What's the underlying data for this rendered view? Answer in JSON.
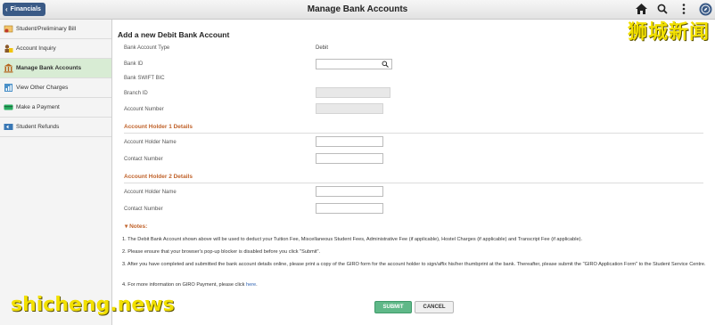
{
  "topbar": {
    "back_label": "Financials",
    "title": "Manage Bank Accounts",
    "icons": [
      "home-icon",
      "search-icon",
      "more-vertical-icon",
      "navbar-compass-icon"
    ]
  },
  "sidebar": {
    "items": [
      {
        "label": "Student/Preliminary Bill",
        "icon": "bill-icon"
      },
      {
        "label": "Account Inquiry",
        "icon": "account-inquiry-icon"
      },
      {
        "label": "Manage Bank Accounts",
        "icon": "bank-icon"
      },
      {
        "label": "View Other Charges",
        "icon": "charges-icon"
      },
      {
        "label": "Make a Payment",
        "icon": "payment-icon"
      },
      {
        "label": "Student Refunds",
        "icon": "refunds-icon"
      }
    ]
  },
  "form": {
    "title": "Add a new Debit Bank Account",
    "bank_account_type_label": "Bank Account Type",
    "bank_account_type_value": "Debit",
    "bank_id_label": "Bank ID",
    "bank_id_value": "",
    "bank_swift_label": "Bank SWIFT BIC",
    "branch_id_label": "Branch ID",
    "account_number_label": "Account Number",
    "holder1_heading": "Account Holder 1 Details",
    "holder1_name_label": "Account Holder Name",
    "holder1_contact_label": "Contact Number",
    "holder2_heading": "Account Holder 2 Details",
    "holder2_name_label": "Account Holder Name",
    "holder2_contact_label": "Contact Number"
  },
  "notes": {
    "heading": "Notes:",
    "items": [
      "1.  The Debit Bank Account shown above will be used to deduct your Tuition Fee, Miscellaneous Student Fees, Administrative Fee (if applicable), Hostel Charges (if applicable) and Transcript Fee (if applicable).",
      "2.  Please ensure that your browser's pop-up blocker is disabled before you click \"Submit\".",
      "3.  After you have completed and submitted the bank account details online, please print a copy of the GIRO form for the account holder to sign/affix his/her thumbprint at the bank. Thereafter, please submit the \"GIRO Application Form\" to the Student Service Centre.",
      "4.  For more information on GIRO Payment, please click "
    ],
    "link_label": "here",
    "link_suffix": "."
  },
  "buttons": {
    "submit_label": "SUBMIT",
    "cancel_label": "CANCEL"
  },
  "watermarks": {
    "chinese": "狮城新闻",
    "english": "shicheng.news"
  },
  "colors": {
    "accent_blue": "#3a5a86",
    "section_orange": "#c0622a",
    "submit_green": "#5fb888",
    "active_sidebar": "#d8ecd4",
    "watermark_yellow": "#f2e000"
  }
}
